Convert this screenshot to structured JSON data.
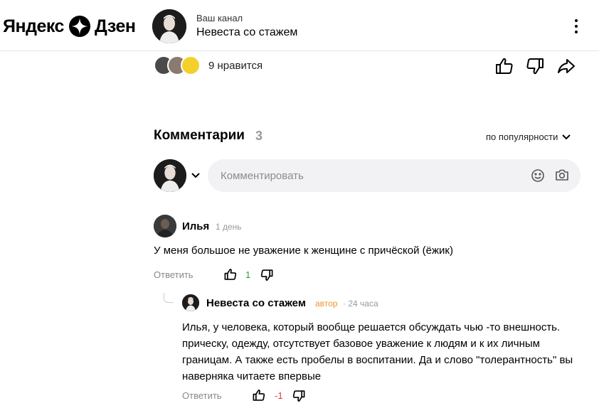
{
  "header": {
    "logo_text_left": "Яндекс",
    "logo_text_right": "Дзен",
    "channel_caption": "Ваш канал",
    "channel_name": "Невеста со стажем"
  },
  "reactions": {
    "likes_text": "9 нравится"
  },
  "comments": {
    "title": "Комментарии",
    "count": "3",
    "sort_label": "по популярности",
    "input_placeholder": "Комментировать",
    "items": [
      {
        "author": "Илья",
        "time": "1 день",
        "text": "У меня большое не уважение к женщине с причёской (ёжик)",
        "reply_label": "Ответить",
        "score": "1"
      },
      {
        "author": "Невеста со стажем",
        "badge": "автор",
        "time": "· 24 часа",
        "text": "Илья, у человека, который вообще решается обсуждать чью -то внешность. прическу, одежду, отсутствует базовое уважение к людям и к их личным границам. А также есть пробелы в воспитании. Да и слово \"толерантность\" вы наверняка читаете впервые",
        "reply_label": "Ответить",
        "score": "-1"
      }
    ]
  },
  "colors": {
    "accent_orange": "#f0942a",
    "positive": "#2d9a3f",
    "negative": "#e03a2f",
    "input_bg": "#f2f2f4"
  }
}
